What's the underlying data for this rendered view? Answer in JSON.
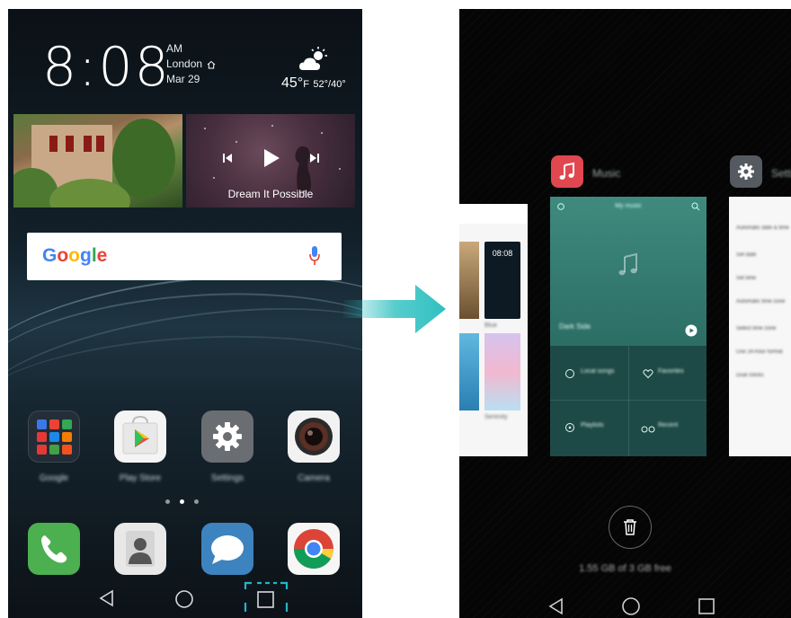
{
  "home": {
    "clock": {
      "time": "8:08",
      "ampm": "AM",
      "city": "London",
      "date": "Mar 29"
    },
    "weather": {
      "temp": "45°",
      "unit": "F",
      "range": "52°/40°",
      "icon": "partly-cloudy-icon"
    },
    "music_widget": {
      "title": "Dream It Possible"
    },
    "search": {
      "logo": "Google",
      "icon": "mic-icon"
    },
    "apps": [
      {
        "label": "Google",
        "icon": "folder-icon"
      },
      {
        "label": "Play Store",
        "icon": "play-store-icon"
      },
      {
        "label": "Settings",
        "icon": "gear-icon"
      },
      {
        "label": "Camera",
        "icon": "camera-icon"
      }
    ],
    "dock": [
      {
        "icon": "phone-icon"
      },
      {
        "icon": "contacts-icon"
      },
      {
        "icon": "messages-icon"
      },
      {
        "icon": "chrome-icon"
      }
    ],
    "page_indicator": {
      "pages": 3,
      "current": 2
    }
  },
  "recents": {
    "cards": [
      {
        "name": "Music",
        "icon": "music-note-icon",
        "color": "#e0474f",
        "header": "My music",
        "track": "Dark Side",
        "items": [
          "Local songs",
          "Favorites",
          "Playlists",
          "Recent"
        ]
      },
      {
        "name": "Settings",
        "icon": "gear-icon",
        "color": "#555a60",
        "rows": [
          "Automatic date & time",
          "Set date",
          "Set time",
          "Automatic time zone",
          "Select time zone",
          "Use 24-hour format",
          "Dual clocks"
        ]
      }
    ],
    "left_card": {
      "time": "08:08",
      "labels": [
        "Blue",
        "Serenity"
      ]
    },
    "memory": "1.55 GB of 3 GB free"
  },
  "colors": {
    "arrow": "#2fc0c0",
    "highlight": "#23b6c8"
  }
}
